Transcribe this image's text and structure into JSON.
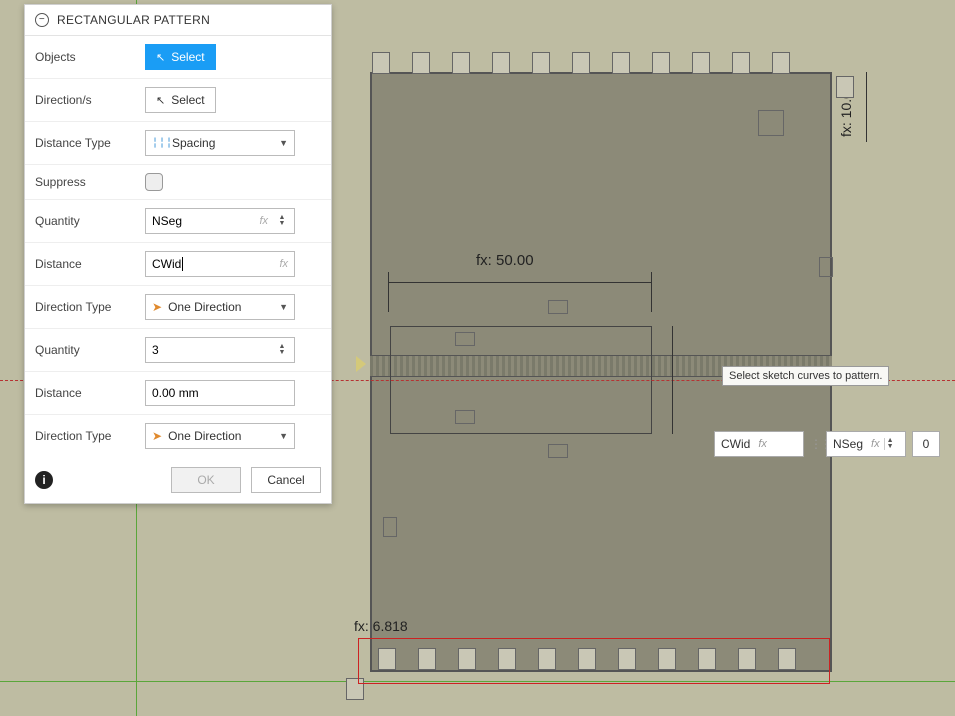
{
  "dialog": {
    "title": "RECTANGULAR PATTERN",
    "rows": {
      "objects": {
        "label": "Objects",
        "button": "Select"
      },
      "directions": {
        "label": "Direction/s",
        "button": "Select"
      },
      "distance_type": {
        "label": "Distance Type",
        "value": "Spacing"
      },
      "suppress": {
        "label": "Suppress"
      },
      "quantity1": {
        "label": "Quantity",
        "value": "NSeg",
        "fx": "fx"
      },
      "distance1": {
        "label": "Distance",
        "value": "CWid",
        "fx": "fx"
      },
      "dir_type1": {
        "label": "Direction Type",
        "value": "One Direction"
      },
      "quantity2": {
        "label": "Quantity",
        "value": "3"
      },
      "distance2": {
        "label": "Distance",
        "value": "0.00 mm"
      },
      "dir_type2": {
        "label": "Direction Type",
        "value": "One Direction"
      }
    },
    "footer": {
      "ok": "OK",
      "cancel": "Cancel"
    }
  },
  "canvas": {
    "dim_50": "fx: 50.00",
    "dim_10": "fx: 10.00",
    "dim_6818": "fx: 6.818",
    "tooltip": "Select sketch curves to pattern."
  },
  "floater": {
    "field1": {
      "value": "CWid",
      "fx": "fx"
    },
    "field2": {
      "value": "NSeg",
      "fx": "fx"
    },
    "field3": {
      "value": "0"
    }
  }
}
